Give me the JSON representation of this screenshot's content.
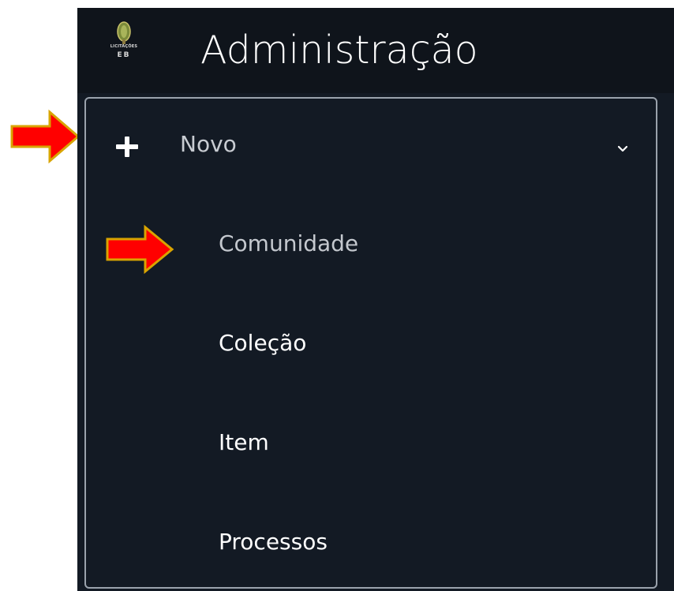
{
  "header": {
    "logo_line1": "LICITAÇÕES",
    "logo_line2": "EB",
    "title": "Administração"
  },
  "menu": {
    "label": "Novo",
    "expanded": true,
    "items": [
      {
        "label": "Comunidade"
      },
      {
        "label": "Coleção"
      },
      {
        "label": "Item"
      },
      {
        "label": "Processos"
      }
    ]
  },
  "colors": {
    "sidebar_bg": "#131a24",
    "header_bg": "#0f141b",
    "menu_border": "#9aa2ac",
    "annotation_arrow": "#ff0000",
    "annotation_arrow_outline": "#d9a400"
  },
  "icons": [
    "logo-icon",
    "plus-icon",
    "chevron-down-icon",
    "arrow-annotation-icon"
  ]
}
